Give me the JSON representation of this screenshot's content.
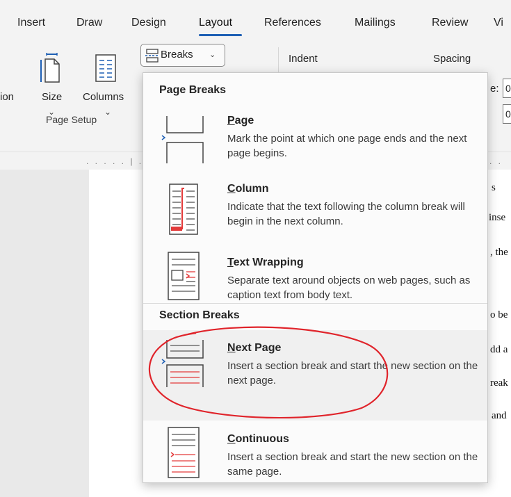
{
  "tabs": [
    {
      "label": "Insert"
    },
    {
      "label": "Draw"
    },
    {
      "label": "Design"
    },
    {
      "label": "Layout"
    },
    {
      "label": "References"
    },
    {
      "label": "Mailings"
    },
    {
      "label": "Review"
    },
    {
      "label": "Vi"
    }
  ],
  "active_tab": "Layout",
  "ribbon": {
    "orientation_partial": "ion",
    "size_label": "Size",
    "columns_label": "Columns",
    "breaks_label": "Breaks",
    "group_label": "Page Setup",
    "indent_label": "Indent",
    "spacing_label": "Spacing",
    "field1_partial": "e:",
    "field1_value": "0",
    "field2_value": "0"
  },
  "doc_fragments": [
    "s",
    "inse",
    ", the",
    "o be",
    "dd a",
    "reak",
    "and"
  ],
  "menu": {
    "page_breaks_header": "Page Breaks",
    "section_breaks_header": "Section Breaks",
    "items": [
      {
        "accel": "P",
        "rest": "age",
        "title": "Page",
        "desc": "Mark the point at which one page ends and the next page begins.",
        "icon": "page-break-icon"
      },
      {
        "accel": "C",
        "rest": "olumn",
        "title": "Column",
        "desc": "Indicate that the text following the column break will begin in the next column.",
        "icon": "column-break-icon"
      },
      {
        "accel": "T",
        "rest": "ext Wrapping",
        "title": "Text Wrapping",
        "desc": "Separate text around objects on web pages, such as caption text from body text.",
        "icon": "text-wrapping-break-icon"
      },
      {
        "accel": "N",
        "rest": "ext Page",
        "title": "Next Page",
        "desc": "Insert a section break and start the new section on the next page.",
        "icon": "next-page-break-icon"
      },
      {
        "accel": "C",
        "rest": "ontinuous",
        "title": "Continuous",
        "desc": "Insert a section break and start the new section on the same page.",
        "icon": "continuous-break-icon"
      }
    ]
  },
  "colors": {
    "accent": "#1e5fb4",
    "annotation": "#e0242b",
    "icon_red": "#e33b3b"
  }
}
